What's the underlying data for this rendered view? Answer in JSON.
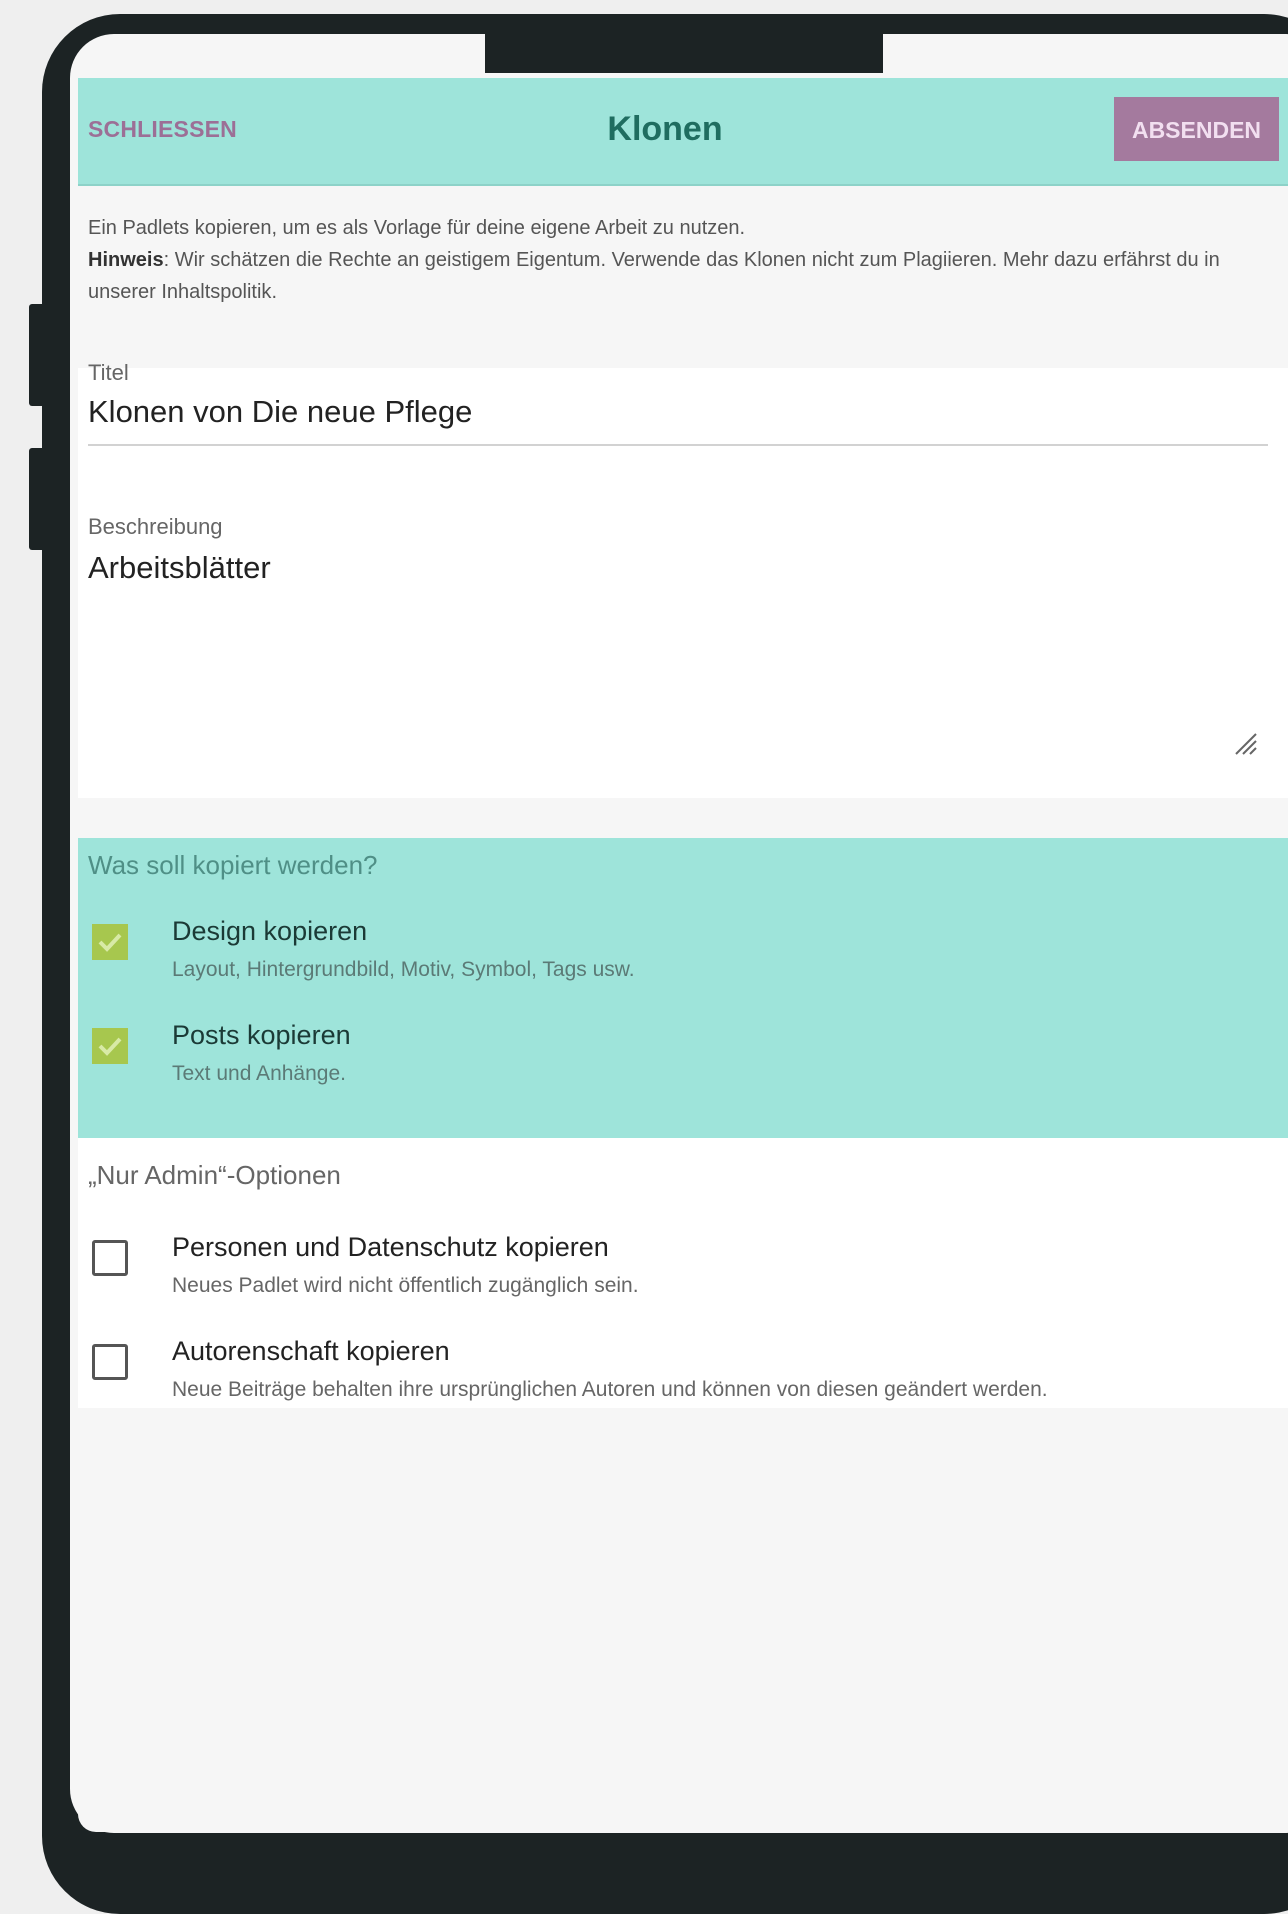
{
  "header": {
    "close_label": "SCHLIESSEN",
    "title": "Klonen",
    "submit_label": "ABSENDEN"
  },
  "intro": {
    "line1": "Ein Padlets kopieren, um es als Vorlage für deine eigene Arbeit zu nutzen.",
    "hint_label": "Hinweis",
    "hint_text": ": Wir schätzen die Rechte an geistigem Eigentum. Verwende das Klonen nicht zum Plagiieren. Mehr dazu erfährst du in unserer ",
    "link_text": "Inhaltspolitik",
    "end": "."
  },
  "form": {
    "title_label": "Titel",
    "title_value": "Klonen von Die neue Pflege",
    "description_label": "Beschreibung",
    "description_value": "Arbeitsblätter"
  },
  "copy_options": {
    "heading": "Was soll kopiert werden?",
    "items": [
      {
        "title": "Design kopieren",
        "description": "Layout, Hintergrundbild, Motiv, Symbol, Tags usw.",
        "checked": true
      },
      {
        "title": "Posts kopieren",
        "description": "Text und Anhänge.",
        "checked": true
      }
    ]
  },
  "admin_options": {
    "heading": "„Nur Admin“-Optionen",
    "items": [
      {
        "title": "Personen und Datenschutz kopieren",
        "description": "Neues Padlet wird nicht öffentlich zugänglich sein.",
        "checked": false
      },
      {
        "title": "Autorenschaft kopieren",
        "description": "Neue Beiträge behalten ihre ursprünglichen Autoren und können von diesen geändert werden.",
        "checked": false
      }
    ]
  },
  "colors": {
    "accent_teal": "#9ee4da",
    "button_mauve": "#a47a9e",
    "checkbox_green": "#a7c74e",
    "device_frame": "#1c2324"
  }
}
